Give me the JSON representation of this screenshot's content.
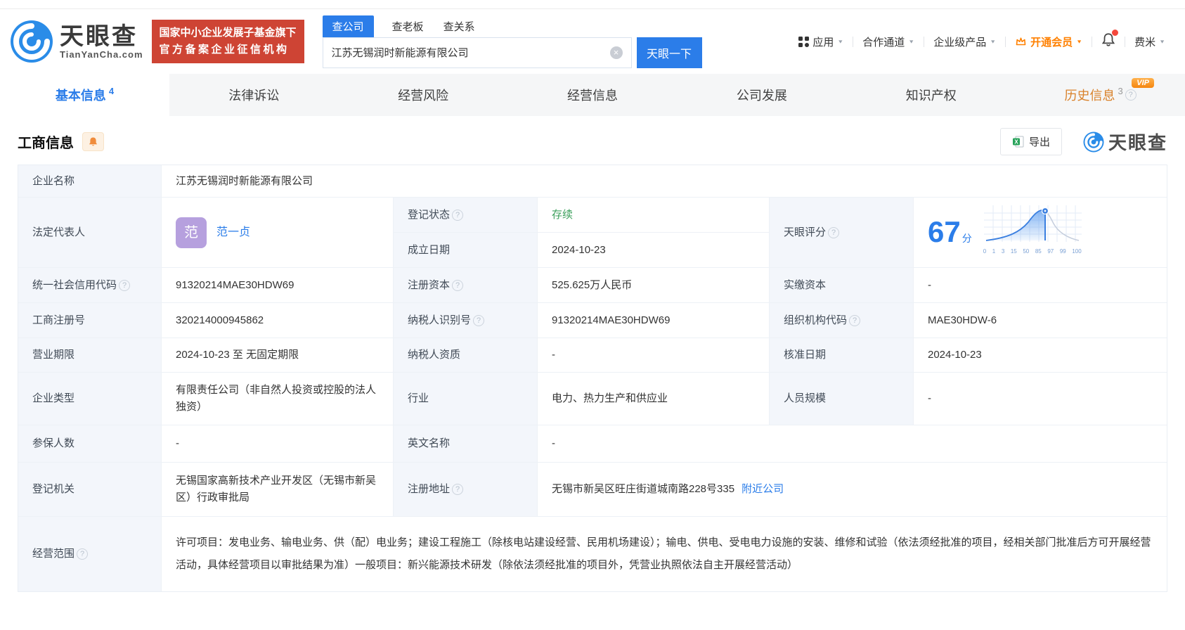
{
  "brand": {
    "name": "天眼查",
    "domain": "TianYanCha.com",
    "badge_line1": "国家中小企业发展子基金旗下",
    "badge_line2": "官方备案企业征信机构",
    "watermark": "天眼查"
  },
  "search": {
    "tab_company": "查公司",
    "tab_boss": "查老板",
    "tab_relation": "查关系",
    "value": "江苏无锡润时新能源有限公司",
    "button": "天眼一下"
  },
  "top_menu": {
    "apps": "应用",
    "partner": "合作通道",
    "enterprise": "企业级产品",
    "vip": "开通会员",
    "user": "费米"
  },
  "tabs": {
    "basic": "基本信息",
    "basic_count": "4",
    "legal": "法律诉讼",
    "risk": "经营风险",
    "operation": "经营信息",
    "development": "公司发展",
    "ip": "知识产权",
    "history": "历史信息",
    "history_count": "3",
    "vip_badge": "VIP"
  },
  "section": {
    "title": "工商信息",
    "export": "导出"
  },
  "info": {
    "company_name_label": "企业名称",
    "company_name": "江苏无锡润时新能源有限公司",
    "legal_rep_label": "法定代表人",
    "legal_rep_avatar": "范",
    "legal_rep_name": "范一贞",
    "reg_status_label": "登记状态",
    "reg_status": "存续",
    "establish_label": "成立日期",
    "establish_date": "2024-10-23",
    "score_label": "天眼评分",
    "score_value": "67",
    "score_unit": "分",
    "score_axis": [
      "0",
      "1",
      "3",
      "15",
      "50",
      "85",
      "97",
      "99",
      "100"
    ],
    "credit_code_label": "统一社会信用代码",
    "credit_code": "91320214MAE30HDW69",
    "reg_capital_label": "注册资本",
    "reg_capital": "525.625万人民币",
    "paid_capital_label": "实缴资本",
    "paid_capital": "-",
    "reg_number_label": "工商注册号",
    "reg_number": "320214000945862",
    "taxpayer_id_label": "纳税人识别号",
    "taxpayer_id": "91320214MAE30HDW69",
    "org_code_label": "组织机构代码",
    "org_code": "MAE30HDW-6",
    "business_term_label": "营业期限",
    "business_term": "2024-10-23 至 无固定期限",
    "taxpayer_quality_label": "纳税人资质",
    "taxpayer_quality": "-",
    "approve_date_label": "核准日期",
    "approve_date": "2024-10-23",
    "company_type_label": "企业类型",
    "company_type": "有限责任公司（非自然人投资或控股的法人独资）",
    "industry_label": "行业",
    "industry": "电力、热力生产和供应业",
    "staff_size_label": "人员规模",
    "staff_size": "-",
    "insured_label": "参保人数",
    "insured": "-",
    "english_name_label": "英文名称",
    "english_name": "-",
    "reg_authority_label": "登记机关",
    "reg_authority": "无锡国家高新技术产业开发区（无锡市新吴区）行政审批局",
    "address_label": "注册地址",
    "address": "无锡市新吴区旺庄街道城南路228号335",
    "nearby_link": "附近公司",
    "business_scope_label": "经营范围",
    "business_scope": "许可项目：发电业务、输电业务、供（配）电业务；建设工程施工（除核电站建设经营、民用机场建设）；输电、供电、受电电力设施的安装、维修和试验（依法须经批准的项目，经相关部门批准后方可开展经营活动，具体经营项目以审批结果为准）一般项目：新兴能源技术研发（除依法须经批准的项目外，凭营业执照依法自主开展经营活动）"
  },
  "colors": {
    "accent": "#2b7de9",
    "member_orange": "#ff8000",
    "status_green": "#3ca05c",
    "badge_red": "#ce4434",
    "history_orange": "#d9822b"
  }
}
